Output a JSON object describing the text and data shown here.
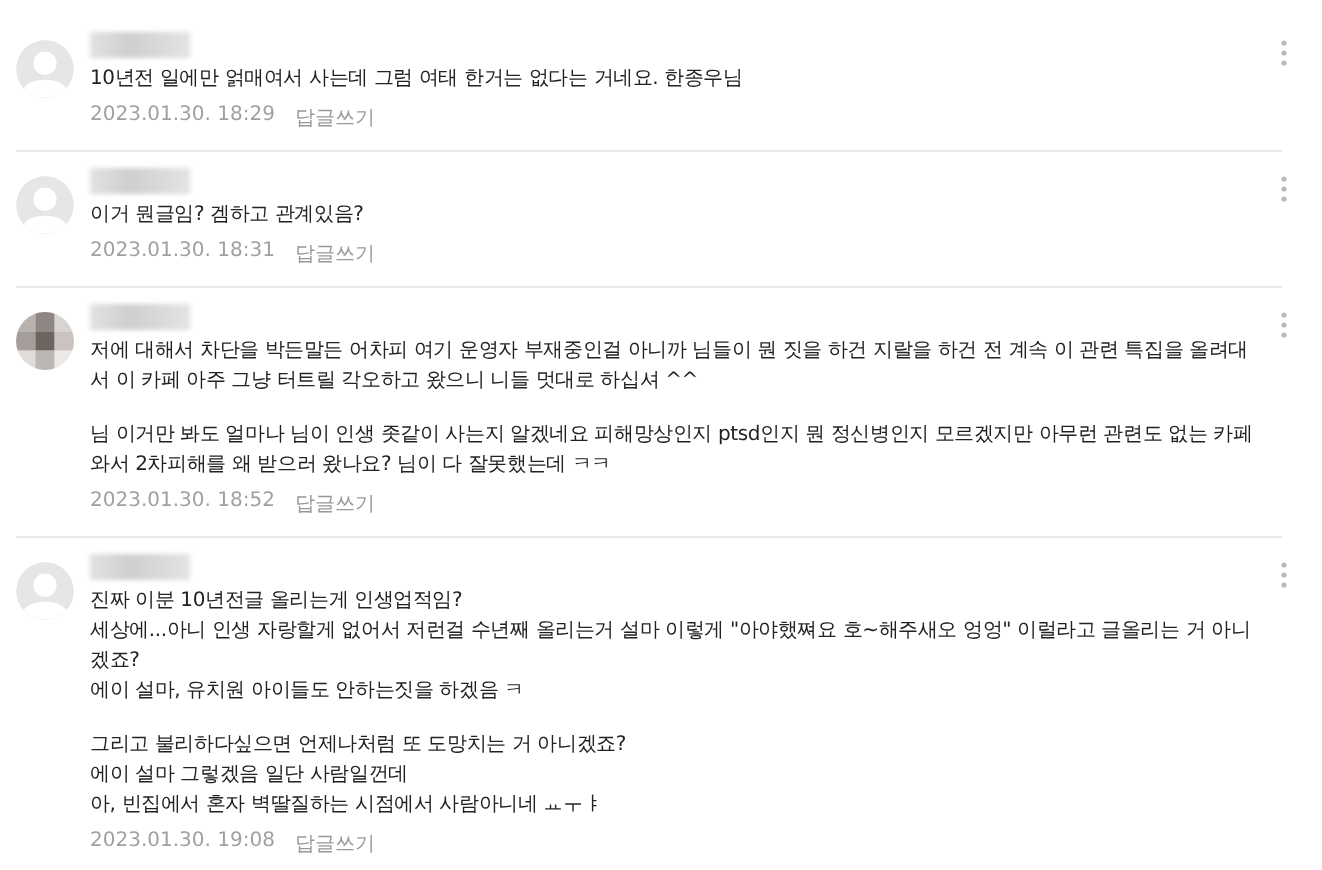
{
  "comments": [
    {
      "kind": "default",
      "paragraphs": [
        [
          "10년전 일에만 얽매여서 사는데 그럼 여태 한거는 없다는 거네요. 한종우님"
        ]
      ],
      "date": "2023.01.30. 18:29",
      "reply": "답글쓰기"
    },
    {
      "kind": "default",
      "paragraphs": [
        [
          "이거 뭔글임? 겜하고 관계있음?"
        ]
      ],
      "date": "2023.01.30. 18:31",
      "reply": "답글쓰기"
    },
    {
      "kind": "mosaic",
      "paragraphs": [
        [
          "저에 대해서 차단을 박든말든 어차피 여기 운영자 부재중인걸 아니까 님들이 뭔 짓을 하건 지랄을 하건 전 계속 이 관련 특집을 올려대서 이 카페 아주 그냥 터트릴 각오하고 왔으니 니들 멋대로 하십셔 ^^"
        ],
        [
          "님 이거만 봐도 얼마나 님이 인생 좃같이 사는지 알겠네요 피해망상인지 ptsd인지 뭔 정신병인지 모르겠지만 아무런 관련도 없는 카페와서 2차피해를 왜 받으러 왔나요? 님이 다 잘못했는데 ㅋㅋ"
        ]
      ],
      "date": "2023.01.30. 18:52",
      "reply": "답글쓰기"
    },
    {
      "kind": "default",
      "paragraphs": [
        [
          "진짜 이분 10년전글 올리는게 인생업적임?",
          "세상에...아니 인생 자랑할게 없어서 저런걸 수년째 올리는거 설마 이렇게 \"아야했쪄요 호~해주새오 엉엉\" 이럴라고 글올리는 거 아니겠죠?",
          "에이 설마, 유치원 아이들도 안하는짓을 하겠음 ㅋ"
        ],
        [
          "그리고 불리하다싶으면 언제나처럼 또 도망치는 거 아니겠죠?",
          "에이 설마 그렇겠음 일단 사람일껀데",
          "아, 빈집에서 혼자 벽딸질하는 시점에서 사람아니네 ㅛㅜㅑ"
        ]
      ],
      "date": "2023.01.30. 19:08",
      "reply": "답글쓰기"
    }
  ]
}
